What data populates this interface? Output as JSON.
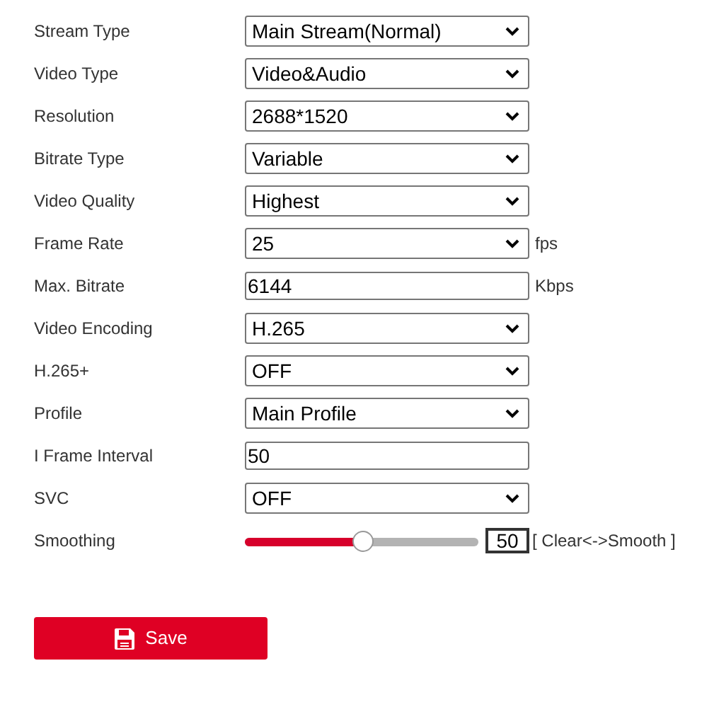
{
  "fields": [
    {
      "kind": "select",
      "label": "Stream Type",
      "value": "Main Stream(Normal)"
    },
    {
      "kind": "select",
      "label": "Video Type",
      "value": "Video&Audio"
    },
    {
      "kind": "select",
      "label": "Resolution",
      "value": "2688*1520"
    },
    {
      "kind": "select",
      "label": "Bitrate Type",
      "value": "Variable"
    },
    {
      "kind": "select",
      "label": "Video Quality",
      "value": "Highest"
    },
    {
      "kind": "select",
      "label": "Frame Rate",
      "value": "25",
      "unit": "fps"
    },
    {
      "kind": "input",
      "label": "Max. Bitrate",
      "value": "6144",
      "unit": "Kbps"
    },
    {
      "kind": "select",
      "label": "Video Encoding",
      "value": "H.265"
    },
    {
      "kind": "select",
      "label": "H.265+",
      "value": "OFF"
    },
    {
      "kind": "select",
      "label": "Profile",
      "value": "Main Profile"
    },
    {
      "kind": "input",
      "label": "I Frame Interval",
      "value": "50"
    },
    {
      "kind": "select",
      "label": "SVC",
      "value": "OFF"
    },
    {
      "kind": "slider",
      "label": "Smoothing",
      "level": 0.5,
      "value": "50",
      "unit": "[ Clear<->Smooth ]"
    }
  ],
  "save_button": {
    "label": "Save"
  }
}
